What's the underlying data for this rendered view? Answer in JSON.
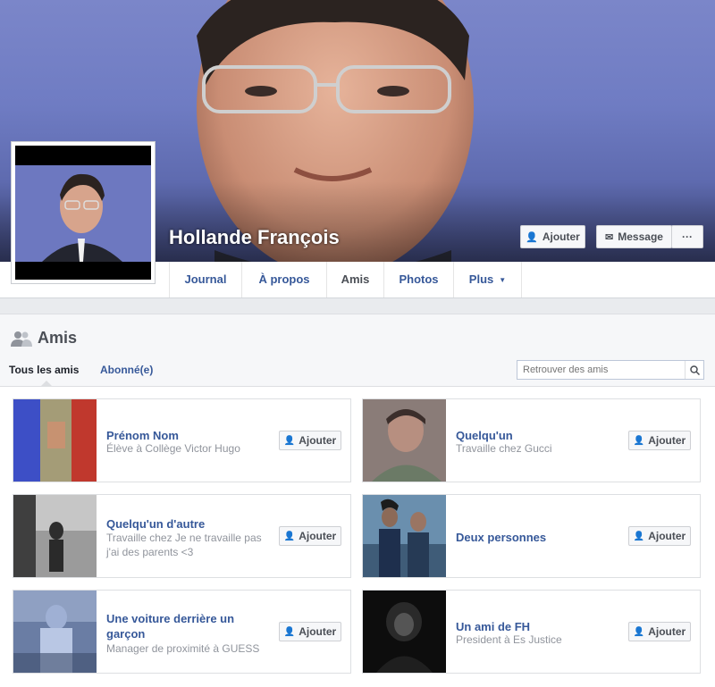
{
  "profile": {
    "name": "Hollande François",
    "actions": {
      "add_label": "Ajouter",
      "message_label": "Message",
      "more_label": "···"
    }
  },
  "tabs": [
    {
      "label": "Journal"
    },
    {
      "label": "À propos"
    },
    {
      "label": "Amis"
    },
    {
      "label": "Photos"
    },
    {
      "label": "Plus"
    }
  ],
  "friends_section": {
    "title": "Amis",
    "subtabs": [
      {
        "label": "Tous les amis"
      },
      {
        "label": "Abonné(e)"
      }
    ],
    "search_placeholder": "Retrouver des amis"
  },
  "friends": [
    {
      "name": "Prénom Nom",
      "sub": "Élève à Collège Victor Hugo",
      "button": "Ajouter"
    },
    {
      "name": "Quelqu'un",
      "sub": "Travaille chez Gucci",
      "button": "Ajouter"
    },
    {
      "name": "Quelqu'un d'autre",
      "sub": "Travaille chez Je ne travaille pas j'ai des parents <3",
      "button": "Ajouter"
    },
    {
      "name": "Deux personnes",
      "sub": "",
      "button": "Ajouter"
    },
    {
      "name": "Une voiture derrière un garçon",
      "sub": "Manager de proximité à GUESS",
      "button": "Ajouter"
    },
    {
      "name": "Un ami de FH",
      "sub": "President à Es Justice",
      "button": "Ajouter"
    }
  ],
  "colors": {
    "link": "#365899",
    "cover": "#6f7cc3",
    "muted": "#90949c"
  }
}
